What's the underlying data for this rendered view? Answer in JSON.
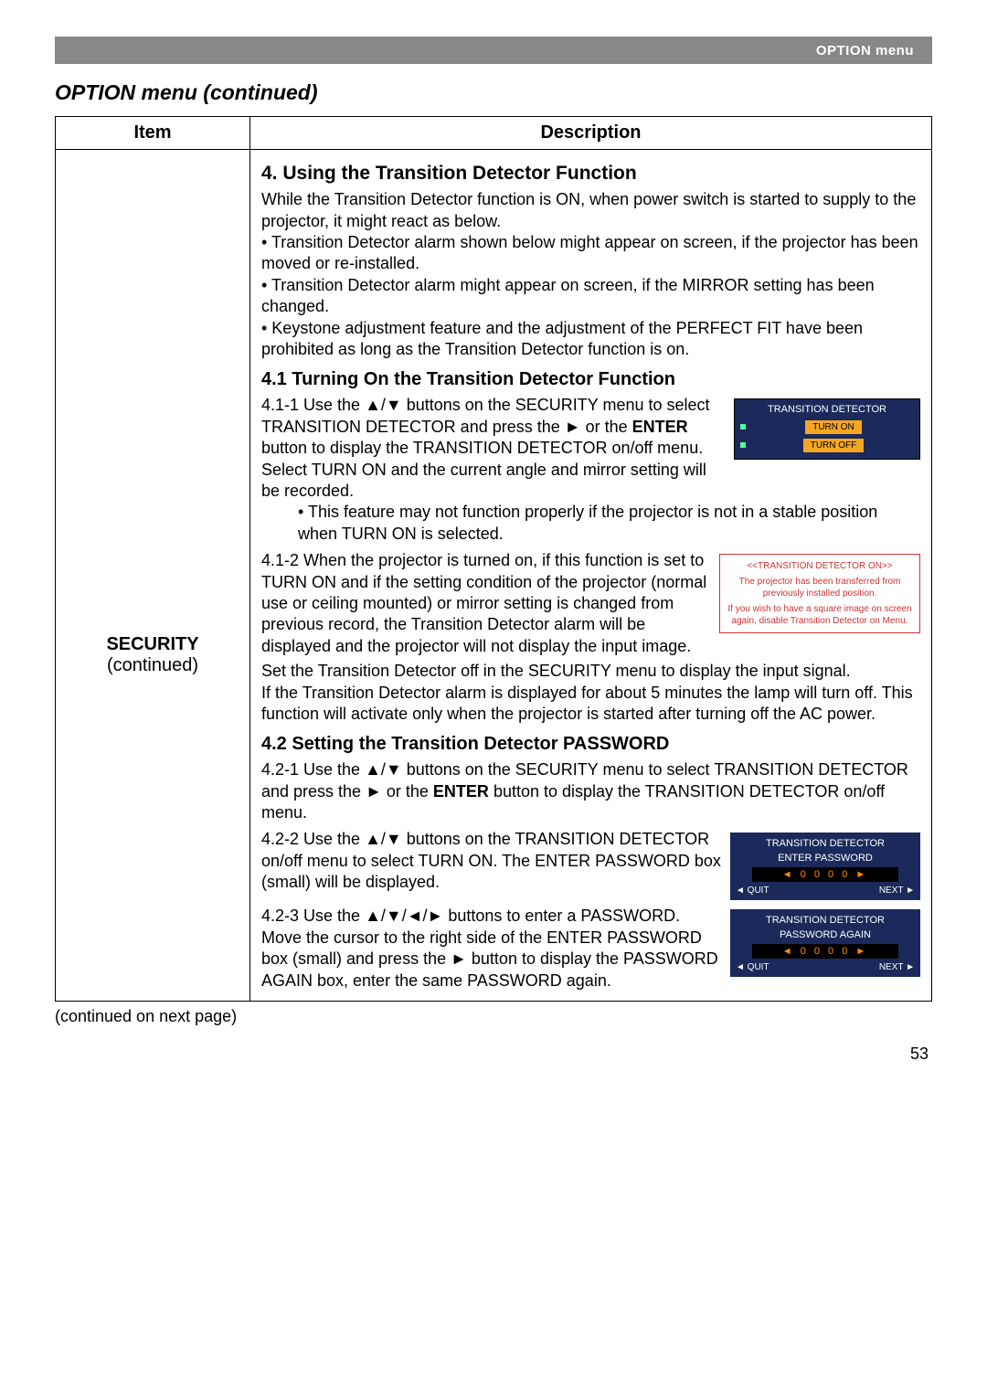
{
  "header": {
    "menu_label": "OPTION menu"
  },
  "section_title": "OPTION menu (continued)",
  "table": {
    "col_item": "Item",
    "col_desc": "Description",
    "item_label": "SECURITY",
    "item_sub": "(continued)"
  },
  "desc": {
    "h4": "4. Using the Transition Detector Function",
    "p4_1": "While the Transition Detector function is ON, when power switch is started to supply to the projector, it might react as below.",
    "p4_b1": "• Transition Detector alarm shown below might appear on screen, if the projector has been moved or re-installed.",
    "p4_b2": "• Transition Detector alarm might appear on screen, if the MIRROR setting has been changed.",
    "p4_b3": "• Keystone adjustment feature and the adjustment of the PERFECT FIT have been prohibited as long as the Transition Detector function is on.",
    "h41": "4.1 Turning On the Transition Detector Function",
    "s411_a": "4.1-1 Use the ▲/▼ buttons on the SECURITY menu to select TRANSITION DETECTOR and press the ► or the ",
    "s411_enter": "ENTER",
    "s411_b": " button to display the TRANSITION DETECTOR on/off menu. Select TURN ON and the current angle and mirror setting will be recorded.",
    "s411_note": "• This feature may not function properly if the projector is not in a stable position when TURN ON is selected.",
    "s412": "4.1-2 When the projector is turned on, if this function is set to TURN ON and if the setting condition of the projector (normal use or ceiling mounted) or mirror setting is changed from previous record, the Transition Detector alarm will be displayed and the projector will not display the input image.",
    "p41_after1": "Set the Transition Detector off in the SECURITY menu to display the input signal.",
    "p41_after2": "If the Transition Detector alarm is displayed for about 5 minutes the lamp will turn off. This function will activate only when the projector is started after turning off the AC power.",
    "h42": "4.2 Setting the Transition Detector PASSWORD",
    "s421_a": "4.2-1 Use the ▲/▼ buttons on the SECURITY menu to select TRANSITION DETECTOR and press the ► or the ",
    "s421_enter": "ENTER",
    "s421_b": " button to display the TRANSITION DETECTOR on/off menu.",
    "s422": "4.2-2 Use the ▲/▼ buttons on the TRANSITION DETECTOR on/off menu to select TURN ON. The ENTER PASSWORD box (small) will be displayed.",
    "s423": "4.2-3 Use the ▲/▼/◄/► buttons to enter a PASSWORD. Move the cursor to the right side of the ENTER PASSWORD box (small) and press the ► button to display the PASSWORD AGAIN box, enter the same PASSWORD again."
  },
  "osd": {
    "td_title": "TRANSITION DETECTOR",
    "turn_on": "TURN ON",
    "turn_off": "TURN OFF",
    "alarm_title": "<<TRANSITION DETECTOR ON>>",
    "alarm_line1": "The projector has been transferred from previously installed position.",
    "alarm_line2": "If you wish to have a square image on screen again, disable Transition Detector on Menu.",
    "pw_title": "TRANSITION DETECTOR",
    "pw_enter": "ENTER PASSWORD",
    "pw_again": "PASSWORD AGAIN",
    "digits": "0 0 0 0",
    "quit": "◄ QUIT",
    "next": "NEXT ►"
  },
  "footer": {
    "cont": "(continued on next page)",
    "page": "53"
  }
}
